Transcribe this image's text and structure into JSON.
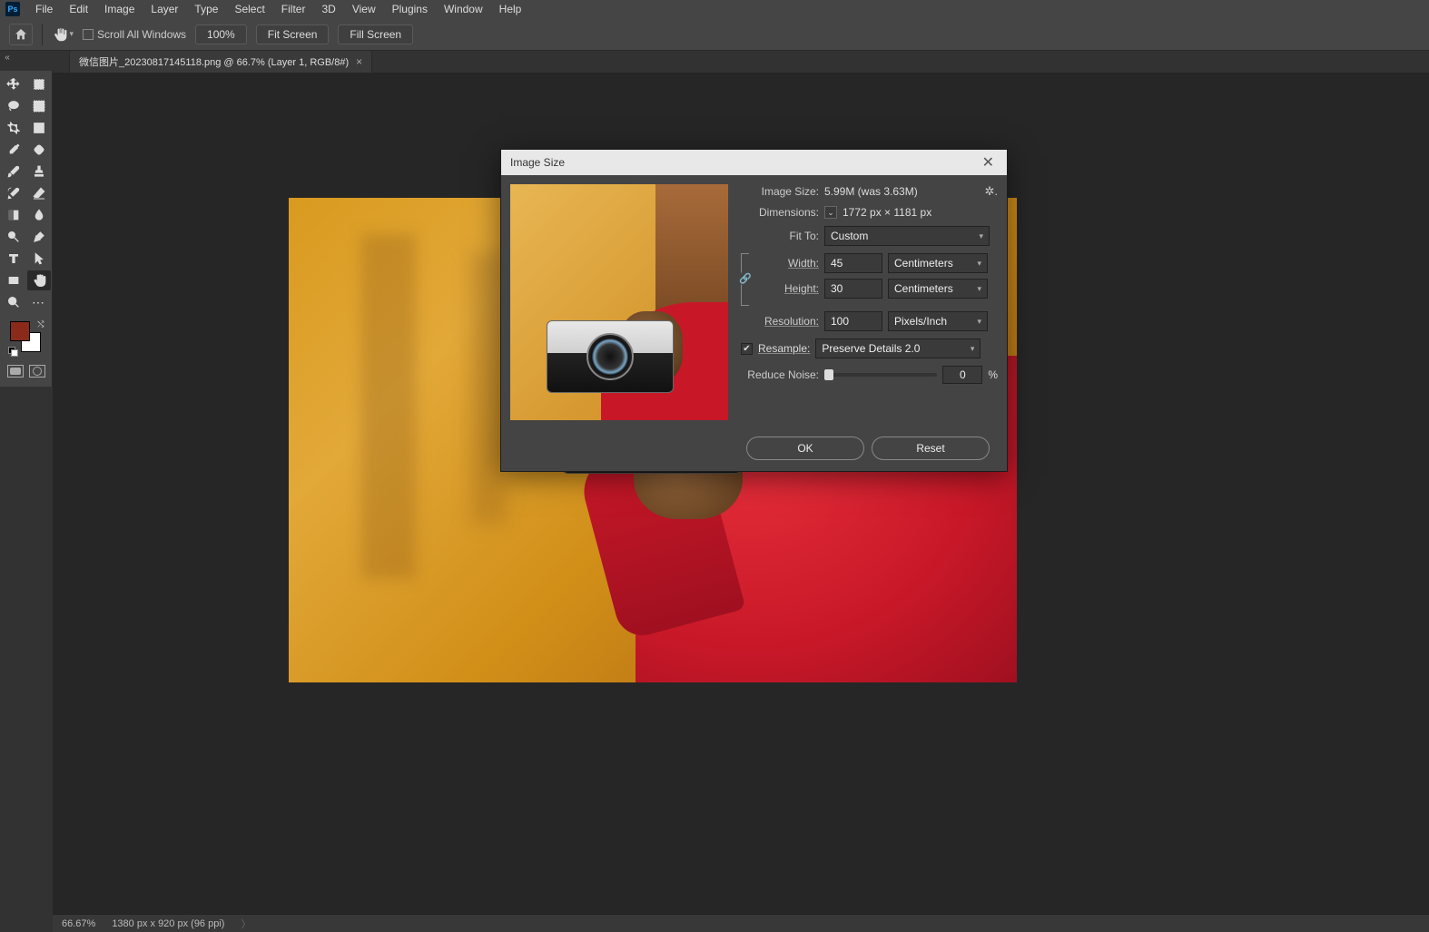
{
  "menu": {
    "items": [
      "File",
      "Edit",
      "Image",
      "Layer",
      "Type",
      "Select",
      "Filter",
      "3D",
      "View",
      "Plugins",
      "Window",
      "Help"
    ],
    "app_abbr": "Ps"
  },
  "options": {
    "scroll_all_label": "Scroll All Windows",
    "zoom_pct": "100%",
    "fit_screen": "Fit Screen",
    "fill_screen": "Fill Screen"
  },
  "doc_tab": {
    "title": "微信图片_20230817145118.png @ 66.7% (Layer 1, RGB/8#)"
  },
  "status": {
    "zoom": "66.67%",
    "doc_info": "1380 px x 920 px (96 ppi)"
  },
  "dialog": {
    "title": "Image Size",
    "image_size_label": "Image Size:",
    "image_size_value": "5.99M (was 3.63M)",
    "dimensions_label": "Dimensions:",
    "dimensions_value": "1772 px  ×  1181 px",
    "fit_to_label": "Fit To:",
    "fit_to_value": "Custom",
    "width_label": "Width:",
    "width_value": "45",
    "width_unit": "Centimeters",
    "height_label": "Height:",
    "height_value": "30",
    "height_unit": "Centimeters",
    "resolution_label": "Resolution:",
    "resolution_value": "100",
    "resolution_unit": "Pixels/Inch",
    "resample_label": "Resample:",
    "resample_value": "Preserve Details 2.0",
    "reduce_noise_label": "Reduce Noise:",
    "reduce_noise_value": "0",
    "pct": "%",
    "ok": "OK",
    "reset": "Reset"
  }
}
